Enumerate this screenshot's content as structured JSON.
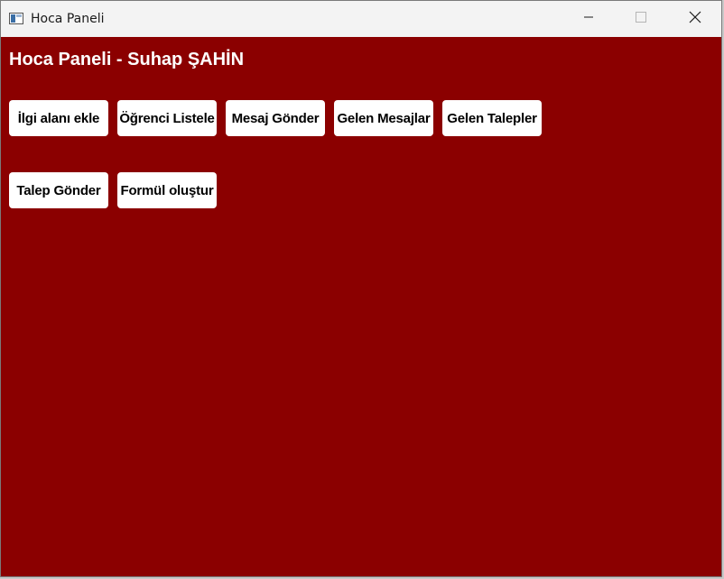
{
  "window": {
    "title": "Hoca Paneli",
    "icons": {
      "app": "window-app-icon",
      "minimize": "minimize-icon",
      "maximize": "maximize-icon",
      "close": "close-icon"
    }
  },
  "panel": {
    "heading": "Hoca Paneli - Suhap ŞAHİN",
    "background_color": "#8b0000",
    "button_color": "#ffffff"
  },
  "buttons": {
    "row1": [
      {
        "label": "İlgi alanı ekle"
      },
      {
        "label": "Öğrenci Listele"
      },
      {
        "label": "Mesaj Gönder"
      },
      {
        "label": "Gelen Mesajlar"
      },
      {
        "label": "Gelen Talepler"
      }
    ],
    "row2": [
      {
        "label": "Talep Gönder"
      },
      {
        "label": "Formül oluştur"
      }
    ]
  }
}
